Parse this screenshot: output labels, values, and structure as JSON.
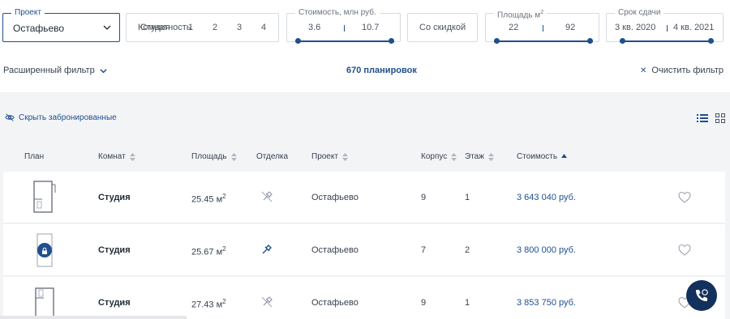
{
  "filters": {
    "project": {
      "label": "Проект",
      "value": "Остафьево"
    },
    "rooms": {
      "label": "Комнатность",
      "options": [
        "Студия",
        "1",
        "2",
        "3",
        "4"
      ]
    },
    "price": {
      "label": "Стоимость, млн руб.",
      "min": "3.6",
      "max": "10.7"
    },
    "discount": {
      "label": "Со скидкой"
    },
    "area": {
      "label_prefix": "Площадь м",
      "label_sup": "2",
      "min": "22",
      "max": "92"
    },
    "deadline": {
      "label": "Срок сдачи",
      "min": "3 кв. 2020",
      "max": "4 кв. 2021"
    }
  },
  "toolbar": {
    "extended_filter": "Расширенный фильтр",
    "count": "670 планировок",
    "clear": "Очистить фильтр",
    "hide_booked": "Скрыть забронированные"
  },
  "table": {
    "headers": {
      "plan": "План",
      "rooms": "Комнат",
      "area": "Площадь",
      "finish": "Отделка",
      "project": "Проект",
      "building": "Корпус",
      "floor": "Этаж",
      "price": "Стоимость"
    },
    "rows": [
      {
        "rooms": "Студия",
        "area": "25.45 м",
        "area_sup": "2",
        "project": "Остафьево",
        "building": "9",
        "floor": "1",
        "price": "3 643 040 руб.",
        "finish_active": false
      },
      {
        "rooms": "Студия",
        "area": "25.67 м",
        "area_sup": "2",
        "project": "Остафьево",
        "building": "7",
        "floor": "2",
        "price": "3 800 000 руб.",
        "finish_active": true
      },
      {
        "rooms": "Студия",
        "area": "27.43 м",
        "area_sup": "2",
        "project": "Остафьево",
        "building": "9",
        "floor": "1",
        "price": "3 853 750 руб.",
        "finish_active": false
      }
    ]
  },
  "colors": {
    "accent": "#1f4f8f",
    "panel": "#f3f4f6",
    "call_button": "#14305c"
  },
  "icons": [
    "chevron-down-icon",
    "close-icon",
    "eye-off-icon",
    "list-view-icon",
    "grid-view-icon",
    "sort-icon",
    "hammer-icon",
    "heart-icon",
    "phone-icon",
    "lock-icon"
  ]
}
